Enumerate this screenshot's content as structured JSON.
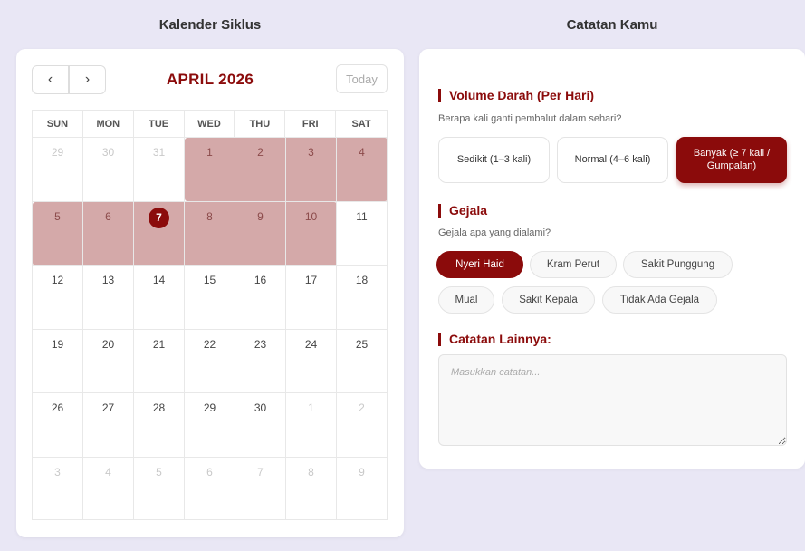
{
  "left_title": "Kalender Siklus",
  "right_title": "Catatan Kamu",
  "calendar": {
    "prev_icon": "‹",
    "next_icon": "›",
    "month_label": "APRIL 2026",
    "today_label": "Today",
    "weekdays": [
      "SUN",
      "MON",
      "TUE",
      "WED",
      "THU",
      "FRI",
      "SAT"
    ],
    "weeks": [
      [
        "29",
        "30",
        "31",
        "1",
        "2",
        "3",
        "4"
      ],
      [
        "5",
        "6",
        "7",
        "8",
        "9",
        "10",
        "11"
      ],
      [
        "12",
        "13",
        "14",
        "15",
        "16",
        "17",
        "18"
      ],
      [
        "19",
        "20",
        "21",
        "22",
        "23",
        "24",
        "25"
      ],
      [
        "26",
        "27",
        "28",
        "29",
        "30",
        "1",
        "2"
      ],
      [
        "3",
        "4",
        "5",
        "6",
        "7",
        "8",
        "9"
      ]
    ],
    "today": "7",
    "period_days": [
      "1",
      "2",
      "3",
      "4",
      "5",
      "6",
      "7",
      "8",
      "9",
      "10"
    ],
    "period_color": "#d4a9a9",
    "accent_color": "#8b0b0b"
  },
  "notes": {
    "volume": {
      "heading": "Volume Darah (Per Hari)",
      "question": "Berapa kali ganti pembalut dalam sehari?",
      "options": [
        "Sedikit (1–3 kali)",
        "Normal (4–6 kali)",
        "Banyak (≥ 7 kali / Gumpalan)"
      ],
      "selected": "Banyak (≥ 7 kali / Gumpalan)"
    },
    "symptoms": {
      "heading": "Gejala",
      "question": "Gejala apa yang dialami?",
      "options": [
        "Nyeri Haid",
        "Kram Perut",
        "Sakit Punggung",
        "Mual",
        "Sakit Kepala",
        "Tidak Ada Gejala"
      ],
      "selected": [
        "Nyeri Haid"
      ]
    },
    "other": {
      "heading": "Catatan Lainnya:",
      "placeholder": "Masukkan catatan...",
      "value": ""
    }
  }
}
